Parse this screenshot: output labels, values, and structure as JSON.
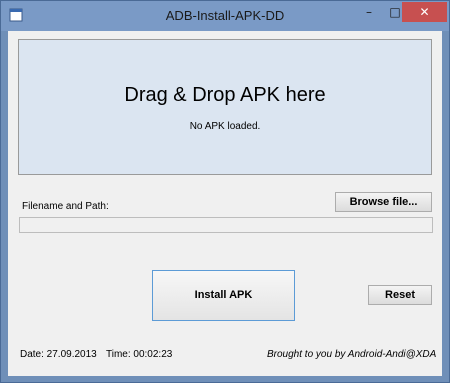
{
  "window": {
    "title": "ADB-Install-APK-DD",
    "minimize_label": "–",
    "maximize_label": "□",
    "close_label": "✕",
    "app_icon": "app-icon"
  },
  "dropzone": {
    "title": "Drag & Drop APK here",
    "status": "No APK loaded."
  },
  "file": {
    "label": "Filename and Path:",
    "path_value": "",
    "browse_label": "Browse file..."
  },
  "actions": {
    "install_label": "Install APK",
    "reset_label": "Reset"
  },
  "footer": {
    "date": "Date: 27.09.2013",
    "time": "Time: 00:02:23",
    "credit": "Brought to you by Android-Andi@XDA"
  },
  "colors": {
    "titlebar": "#7a9ac6",
    "close_button": "#c75050",
    "dropzone_bg": "#dbe5f1",
    "install_border": "#5c9bd6"
  }
}
